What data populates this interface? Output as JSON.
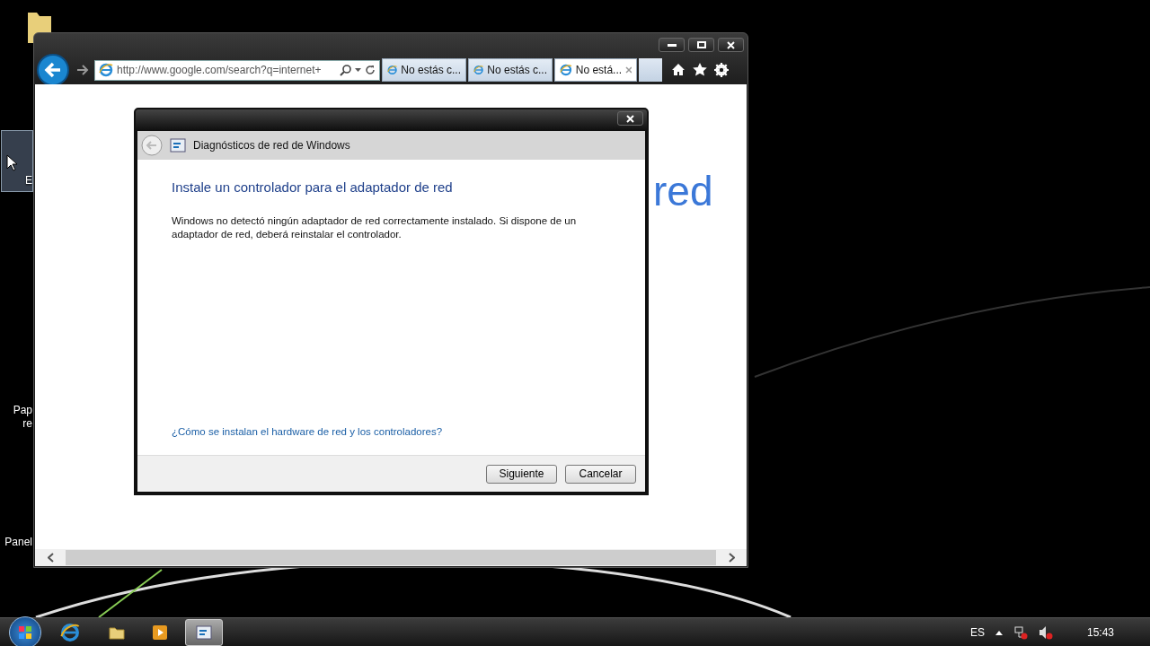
{
  "desktop_icons": [
    {
      "lines": [
        "E"
      ],
      "selected": true
    },
    {
      "lines": [
        "Pap",
        "re"
      ],
      "selected": false
    },
    {
      "lines": [
        "Panel"
      ],
      "selected": false
    }
  ],
  "browser": {
    "address": "http://www.google.com/search?q=internet+",
    "tabs": [
      {
        "label": "No estás c...",
        "selected": false
      },
      {
        "label": "No estás c...",
        "selected": false
      },
      {
        "label": "No está...",
        "selected": true
      }
    ],
    "page_text": "red"
  },
  "dialog": {
    "title": "Diagnósticos de red de Windows",
    "heading": "Instale un controlador para el adaptador de red",
    "body": "Windows no detectó ningún adaptador de red correctamente instalado. Si dispone de un adaptador de red, deberá reinstalar el controlador.",
    "link": "¿Cómo se instalan el hardware de red y los controladores?",
    "buttons": [
      "Siguiente",
      "Cancelar"
    ]
  },
  "taskbar": {
    "items": [
      {
        "kind": "ie",
        "selected": false
      },
      {
        "kind": "folder",
        "selected": false
      },
      {
        "kind": "media",
        "selected": false
      },
      {
        "kind": "diagnostics",
        "selected": true
      }
    ],
    "language": "ES",
    "clock": "15:43"
  }
}
